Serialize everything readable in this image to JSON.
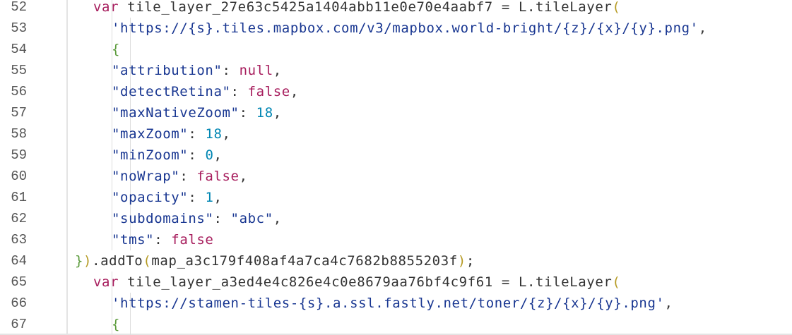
{
  "editor": {
    "lines": [
      {
        "n": "52",
        "indent": 2,
        "segs": [
          {
            "c": "kw",
            "t": "var"
          },
          {
            "c": "plain",
            "t": " tile_layer_27e63c5425a1404abb11e0e70e4aabf7 "
          },
          {
            "c": "op",
            "t": "="
          },
          {
            "c": "plain",
            "t": " L.tileLayer"
          },
          {
            "c": "paren",
            "t": "("
          }
        ]
      },
      {
        "n": "53",
        "indent": 4,
        "segs": [
          {
            "c": "str",
            "t": "'https://{s}.tiles.mapbox.com/v3/mapbox.world-bright/{z}/{x}/{y}.png'"
          },
          {
            "c": "plain",
            "t": ","
          }
        ]
      },
      {
        "n": "54",
        "indent": 4,
        "segs": [
          {
            "c": "brace",
            "t": "{"
          }
        ]
      },
      {
        "n": "55",
        "indent": 4,
        "segs": [
          {
            "c": "str",
            "t": "\"attribution\""
          },
          {
            "c": "plain",
            "t": ": "
          },
          {
            "c": "kw",
            "t": "null"
          },
          {
            "c": "plain",
            "t": ","
          }
        ]
      },
      {
        "n": "56",
        "indent": 4,
        "segs": [
          {
            "c": "str",
            "t": "\"detectRetina\""
          },
          {
            "c": "plain",
            "t": ": "
          },
          {
            "c": "kw",
            "t": "false"
          },
          {
            "c": "plain",
            "t": ","
          }
        ]
      },
      {
        "n": "57",
        "indent": 4,
        "segs": [
          {
            "c": "str",
            "t": "\"maxNativeZoom\""
          },
          {
            "c": "plain",
            "t": ": "
          },
          {
            "c": "num",
            "t": "18"
          },
          {
            "c": "plain",
            "t": ","
          }
        ]
      },
      {
        "n": "58",
        "indent": 4,
        "segs": [
          {
            "c": "str",
            "t": "\"maxZoom\""
          },
          {
            "c": "plain",
            "t": ": "
          },
          {
            "c": "num",
            "t": "18"
          },
          {
            "c": "plain",
            "t": ","
          }
        ]
      },
      {
        "n": "59",
        "indent": 4,
        "segs": [
          {
            "c": "str",
            "t": "\"minZoom\""
          },
          {
            "c": "plain",
            "t": ": "
          },
          {
            "c": "num",
            "t": "0"
          },
          {
            "c": "plain",
            "t": ","
          }
        ]
      },
      {
        "n": "60",
        "indent": 4,
        "segs": [
          {
            "c": "str",
            "t": "\"noWrap\""
          },
          {
            "c": "plain",
            "t": ": "
          },
          {
            "c": "kw",
            "t": "false"
          },
          {
            "c": "plain",
            "t": ","
          }
        ]
      },
      {
        "n": "61",
        "indent": 4,
        "segs": [
          {
            "c": "str",
            "t": "\"opacity\""
          },
          {
            "c": "plain",
            "t": ": "
          },
          {
            "c": "num",
            "t": "1"
          },
          {
            "c": "plain",
            "t": ","
          }
        ]
      },
      {
        "n": "62",
        "indent": 4,
        "segs": [
          {
            "c": "str",
            "t": "\"subdomains\""
          },
          {
            "c": "plain",
            "t": ": "
          },
          {
            "c": "str",
            "t": "\"abc\""
          },
          {
            "c": "plain",
            "t": ","
          }
        ]
      },
      {
        "n": "63",
        "indent": 4,
        "segs": [
          {
            "c": "str",
            "t": "\"tms\""
          },
          {
            "c": "plain",
            "t": ": "
          },
          {
            "c": "kw",
            "t": "false"
          }
        ]
      },
      {
        "n": "64",
        "indent": 0,
        "segs": [
          {
            "c": "brace",
            "t": "}"
          },
          {
            "c": "paren",
            "t": ")"
          },
          {
            "c": "plain",
            "t": ".addTo"
          },
          {
            "c": "paren",
            "t": "("
          },
          {
            "c": "plain",
            "t": "map_a3c179f408af4a7ca4c7682b8855203f"
          },
          {
            "c": "paren",
            "t": ")"
          },
          {
            "c": "plain",
            "t": ";"
          }
        ]
      },
      {
        "n": "65",
        "indent": 2,
        "segs": [
          {
            "c": "kw",
            "t": "var"
          },
          {
            "c": "plain",
            "t": " tile_layer_a3ed4e4c826e4c0e8679aa76bf4c9f61 "
          },
          {
            "c": "op",
            "t": "="
          },
          {
            "c": "plain",
            "t": " L.tileLayer"
          },
          {
            "c": "paren",
            "t": "("
          }
        ]
      },
      {
        "n": "66",
        "indent": 4,
        "segs": [
          {
            "c": "str",
            "t": "'https://stamen-tiles-{s}.a.ssl.fastly.net/toner/{z}/{x}/{y}.png'"
          },
          {
            "c": "plain",
            "t": ","
          }
        ]
      },
      {
        "n": "67",
        "indent": 4,
        "segs": [
          {
            "c": "brace",
            "t": "{"
          }
        ]
      }
    ]
  },
  "colors": {
    "keyword": "#a71d5d",
    "string": "#183691",
    "number": "#0086b3",
    "brace": "#5a9a3a",
    "paren": "#b59a22",
    "text": "#333333"
  }
}
